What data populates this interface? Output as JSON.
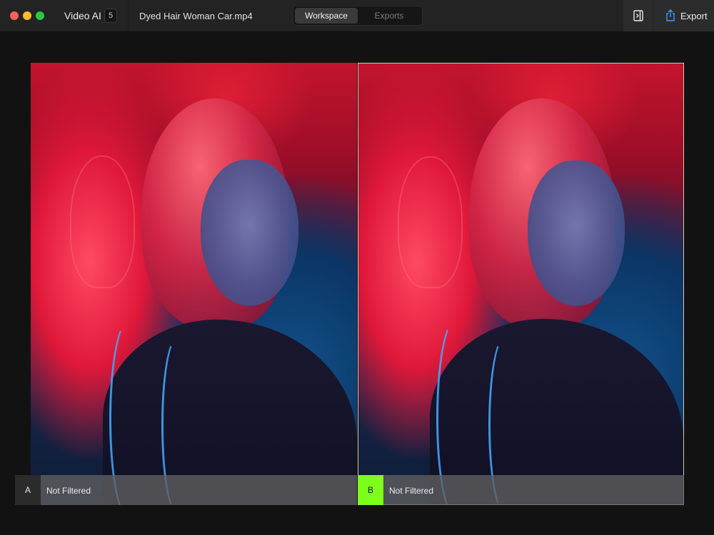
{
  "window": {
    "app_name": "Video AI",
    "badge_count": "5",
    "file_name": "Dyed Hair Woman Car.mp4"
  },
  "tabs": [
    {
      "label": "Workspace",
      "active": true
    },
    {
      "label": "Exports",
      "active": false
    }
  ],
  "toolbar": {
    "sidebar_icon": "sidebar-toggle-icon",
    "export_icon": "share-icon",
    "export_label": "Export"
  },
  "comparison": {
    "panel_a": {
      "marker": "A",
      "status": "Not Filtered",
      "marker_color": "#2b2b2b"
    },
    "panel_b": {
      "marker": "B",
      "status": "Not Filtered",
      "marker_color": "#7dff1a"
    }
  },
  "colors": {
    "accent_selected": "#7dff1a",
    "titlebar": "#232323"
  }
}
